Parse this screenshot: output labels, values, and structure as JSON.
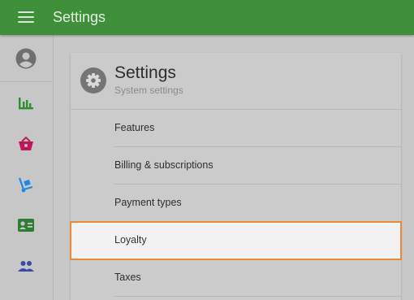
{
  "app": {
    "title": "Settings"
  },
  "sidebar": {
    "items": [
      {
        "name": "reports",
        "icon": "bar-chart-icon",
        "color": "#2f8f2f"
      },
      {
        "name": "sales",
        "icon": "basket-icon",
        "color": "#c2185b"
      },
      {
        "name": "inventory",
        "icon": "hand-truck-icon",
        "color": "#1e88e5"
      },
      {
        "name": "customers",
        "icon": "contact-card-icon",
        "color": "#2e7d32"
      },
      {
        "name": "employees",
        "icon": "people-icon",
        "color": "#3949ab"
      }
    ]
  },
  "card": {
    "title": "Settings",
    "subtitle": "System settings",
    "menu": [
      {
        "label": "Features"
      },
      {
        "label": "Billing & subscriptions"
      },
      {
        "label": "Payment types"
      },
      {
        "label": "Loyalty",
        "selected": true
      },
      {
        "label": "Taxes"
      }
    ]
  },
  "colors": {
    "topbar": "#3f8f3a",
    "highlight": "#ed8a37"
  }
}
